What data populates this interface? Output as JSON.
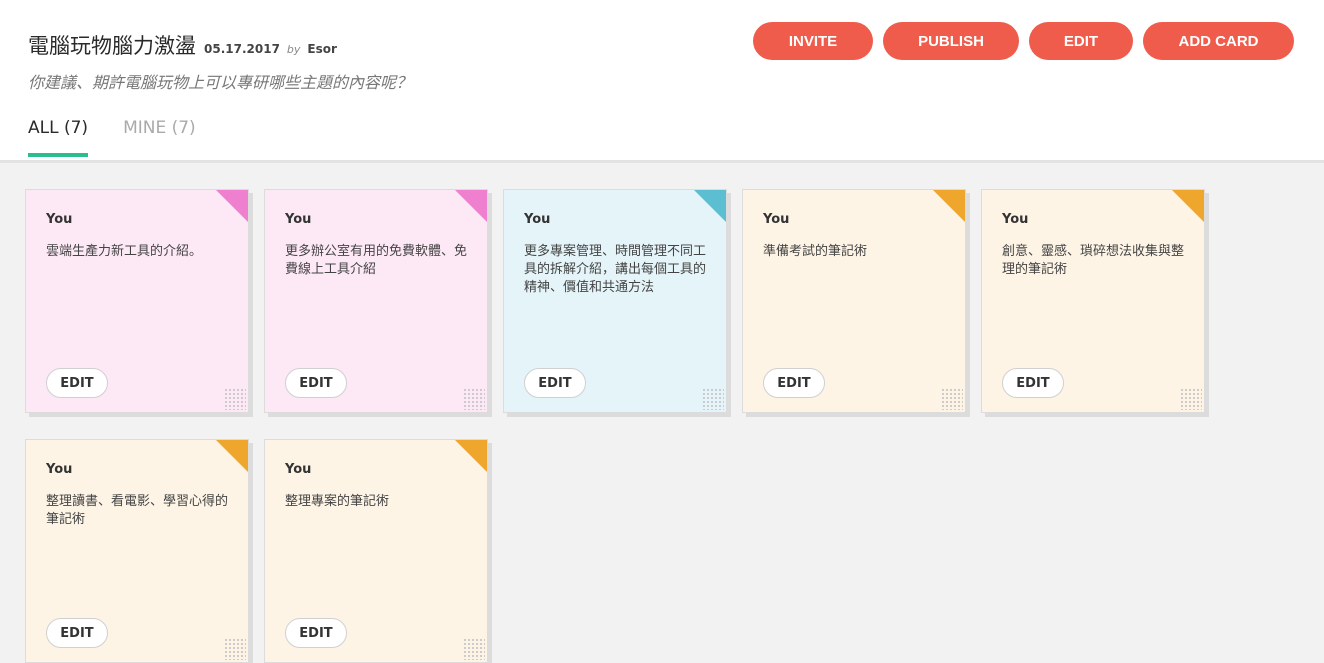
{
  "board": {
    "title": "電腦玩物腦力激盪",
    "date": "05.17.2017",
    "by_label": "by",
    "author": "Esor",
    "subtitle": "你建議、期許電腦玩物上可以專研哪些主題的內容呢？"
  },
  "actions": {
    "invite": "INVITE",
    "publish": "PUBLISH",
    "edit": "EDIT",
    "add_card": "ADD CARD"
  },
  "tabs": {
    "all": "ALL (7)",
    "mine": "MINE (7)"
  },
  "colors": {
    "pink_bg": "#fde8f6",
    "pink_corner": "#ef80cf",
    "blue_bg": "#e4f4f8",
    "blue_corner": "#5bbfd1",
    "cream_bg": "#fdf4e6",
    "orange_corner": "#eea62c",
    "accent": "#f05c4b",
    "tab_underline": "#2bbd8e"
  },
  "cards": [
    {
      "author": "You",
      "text": "雲端生產力新工具的介紹。",
      "edit_label": "EDIT"
    },
    {
      "author": "You",
      "text": "更多辦公室有用的免費軟體、免費線上工具介紹",
      "edit_label": "EDIT"
    },
    {
      "author": "You",
      "text": "更多專案管理、時間管理不同工具的拆解介紹，講出每個工具的精神、價值和共通方法",
      "edit_label": "EDIT"
    },
    {
      "author": "You",
      "text": "準備考試的筆記術",
      "edit_label": "EDIT"
    },
    {
      "author": "You",
      "text": "創意、靈感、瑣碎想法收集與整理的筆記術",
      "edit_label": "EDIT"
    },
    {
      "author": "You",
      "text": "整理讀書、看電影、學習心得的筆記術",
      "edit_label": "EDIT"
    },
    {
      "author": "You",
      "text": "整理專案的筆記術",
      "edit_label": "EDIT"
    }
  ]
}
